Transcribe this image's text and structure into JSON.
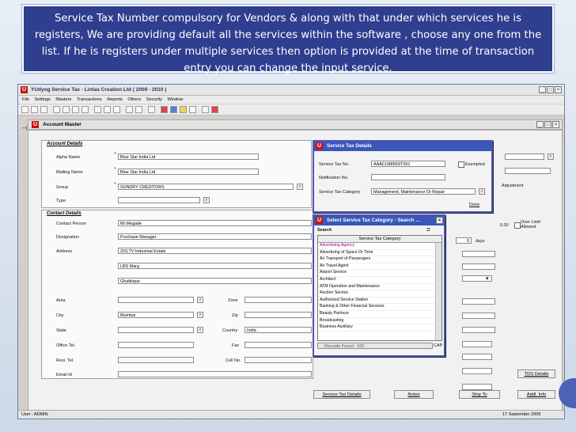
{
  "banner": {
    "text": "Service Tax Number compulsory for Vendors & along with that under which services he is registers, We are providing default all the services within the software , choose any one from the list. If he is registers under multiple services then option is provided at the time of transaction entry you can change the input service."
  },
  "app": {
    "title": "YUdyog Service Tax  -  Lintas Creation Ltd ( 2009 - 2010 )",
    "menu": [
      "File",
      "Settings",
      "Masters",
      "Transactions",
      "Reports",
      "Others",
      "Security",
      "Window"
    ]
  },
  "account_master": {
    "title": "Account Master",
    "account_details": {
      "heading": "Account Details",
      "alpha_name_label": "Alpha Name",
      "alpha_name_value": "Blue Star India Ltd",
      "mailing_name_label": "Mailing Name",
      "mailing_name_value": "Blue Star India Ltd",
      "group_label": "Group",
      "group_value": "SUNDRY CREDITORS",
      "type_label": "Type",
      "type_value": ""
    },
    "contact_details": {
      "heading": "Contact Details",
      "contact_person_label": "Contact Person",
      "contact_person_value": "Mr.Megade",
      "designation_label": "Designation",
      "designation_value": "Purchase Manager",
      "address_label": "Address",
      "address1": "203,TV Industrial Estate",
      "address2": "LBS Marg",
      "address3": "Ghatkopar",
      "area_label": "Area",
      "zone_label": "Zone",
      "city_label": "City",
      "city_value": "Mumbai",
      "zip_label": "Zip",
      "state_label": "State",
      "country_label": "Country",
      "country_value": "India",
      "office_tel_label": "Office Tel.",
      "fax_label": "Fax",
      "resi_tel_label": "Resi. Tel.",
      "cell_label": "Cell No.",
      "email_label": "Email Id"
    },
    "right_panel": {
      "balance_value": "0.00",
      "over_limit_label": "Over Limit Allowed",
      "days_value": "0",
      "days_label": "days",
      "adjustment_label": "Adjustment"
    },
    "buttons": {
      "service_tax_details": "Service Tax Details",
      "notes": "Notes",
      "ship_to": "Ship To",
      "tds_details": "TDS Details",
      "addl_info": "Addl. Info"
    }
  },
  "service_tax_popup": {
    "title": "Service Tax Details",
    "no_label": "Service Tax No.",
    "no_value": "AAACU8856ST001",
    "exempted_label": "Exempted",
    "notification_label": "Notification No.",
    "category_label": "Service Tax Category",
    "category_value": "Management, Maintenance Or Repair",
    "done_label": "Done"
  },
  "select_popup": {
    "title": "Select Service Tax Category - Search ...",
    "search_label": "Search",
    "column_header": "Service Tax Category",
    "items": [
      "Advertising Agency",
      "Advertising of Space Or Time",
      "Air Transport of Passengers",
      "Air Travel Agent",
      "Airport Service",
      "Architect",
      "ATM Operation and Maintenance",
      "Auction Service",
      "Authorized Service Station",
      "Banking & Other Financial Services",
      "Beauty Parlours",
      "Broadcasting",
      "Business Auxiliary"
    ],
    "records_found": "Records Found : 102",
    "caps": "CAP"
  },
  "status": {
    "user": "User : ADMIN",
    "date": "17 September 2009"
  }
}
